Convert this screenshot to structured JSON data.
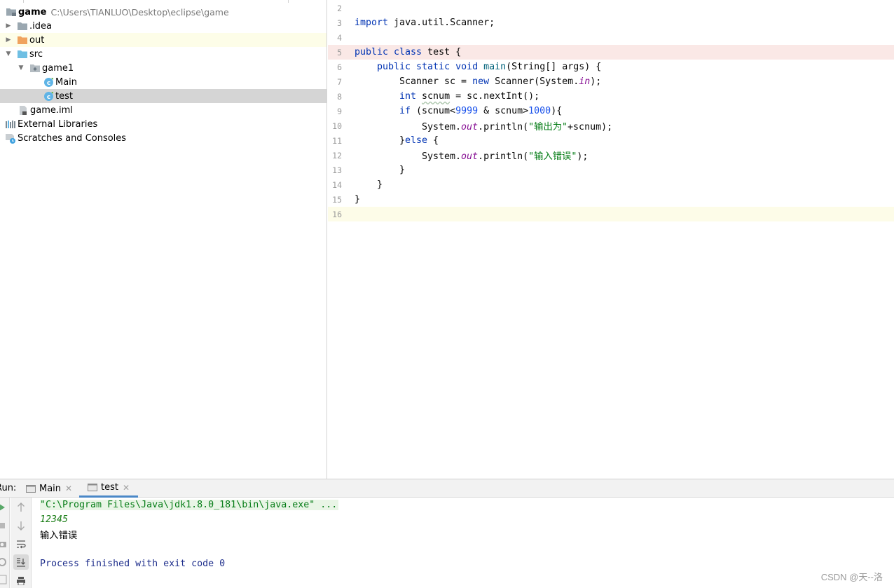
{
  "project_tree": {
    "items": [
      {
        "label": "game",
        "path": "C:\\Users\\TIANLUO\\Desktop\\eclipse\\game"
      },
      {
        "label": ".idea"
      },
      {
        "label": "out"
      },
      {
        "label": "src"
      },
      {
        "label": "game1"
      },
      {
        "label": "Main"
      },
      {
        "label": "test"
      },
      {
        "label": "game.iml"
      },
      {
        "label": "External Libraries"
      },
      {
        "label": "Scratches and Consoles"
      }
    ]
  },
  "editor": {
    "line_numbers": [
      "2",
      "3",
      "4",
      "5",
      "6",
      "7",
      "8",
      "9",
      "10",
      "11",
      "12",
      "13",
      "14",
      "15",
      "16"
    ],
    "lines": {
      "l3": {
        "a": "import",
        "b": " java.util.Scanner;"
      },
      "l5": {
        "a": "public class",
        "b": " test {"
      },
      "l6": {
        "a": "public static void",
        "b": " ",
        "c": "main",
        "d": "(String[] args) {"
      },
      "l7": {
        "a": "Scanner sc = ",
        "b": "new",
        "c": " Scanner(System.",
        "d": "in",
        "e": ");"
      },
      "l8": {
        "a": "int",
        "b": " ",
        "c": "scnum",
        "d": " = sc.nextInt();"
      },
      "l9": {
        "a": "if",
        "b": " (scnum<",
        "c": "9999",
        "d": " & scnum>",
        "e": "1000",
        "f": "){"
      },
      "l10": {
        "a": "System.",
        "b": "out",
        "c": ".println(",
        "d": "\"输出为\"",
        "e": "+scnum);"
      },
      "l11": {
        "a": "}",
        "b": "else",
        "c": " {"
      },
      "l12": {
        "a": "System.",
        "b": "out",
        "c": ".println(",
        "d": "\"输入错误\"",
        "e": ");"
      },
      "l13": "}",
      "l14": "}",
      "l15": "}"
    }
  },
  "run_panel": {
    "title": "Run:",
    "tabs": [
      {
        "label": "Main"
      },
      {
        "label": "test"
      }
    ],
    "console": {
      "command": "\"C:\\Program Files\\Java\\jdk1.8.0_181\\bin\\java.exe\" ...",
      "input": "12345",
      "output": "输入错误",
      "exit": "Process finished with exit code 0"
    }
  },
  "watermark": "CSDN @天--洛",
  "colors": {
    "keyword": "#0033b3",
    "number": "#1750eb",
    "string": "#067d17",
    "field": "#871094",
    "breakpoint_line": "#fae8e6",
    "current_line": "#fdfce8",
    "selected_row": "#d5d5d5"
  }
}
